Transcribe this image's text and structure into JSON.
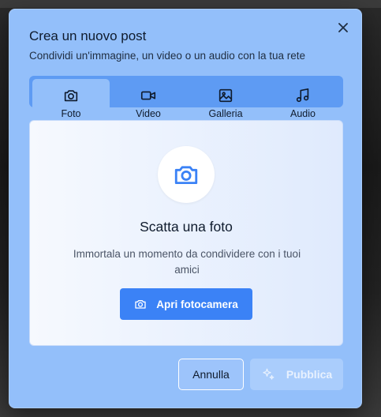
{
  "dialog": {
    "title": "Crea un nuovo post",
    "subtitle": "Condividi un'immagine, un video o un audio con la tua rete",
    "close_icon": "close-icon"
  },
  "tabs": [
    {
      "label": "Foto",
      "icon": "camera-icon",
      "active": true
    },
    {
      "label": "Video",
      "icon": "video-icon",
      "active": false
    },
    {
      "label": "Galleria",
      "icon": "image-icon",
      "active": false
    },
    {
      "label": "Audio",
      "icon": "music-icon",
      "active": false
    }
  ],
  "panel": {
    "icon": "camera-icon",
    "heading": "Scatta una foto",
    "description": "Immortala un momento da condividere con i tuoi amici",
    "button_label": "Apri fotocamera"
  },
  "footer": {
    "cancel_label": "Annulla",
    "publish_label": "Pubblica",
    "publish_icon": "sparkles-icon"
  },
  "colors": {
    "accent": "#3b82f6",
    "dialog_bg": "#93bffa",
    "tabs_bg": "#5e9bf3"
  }
}
